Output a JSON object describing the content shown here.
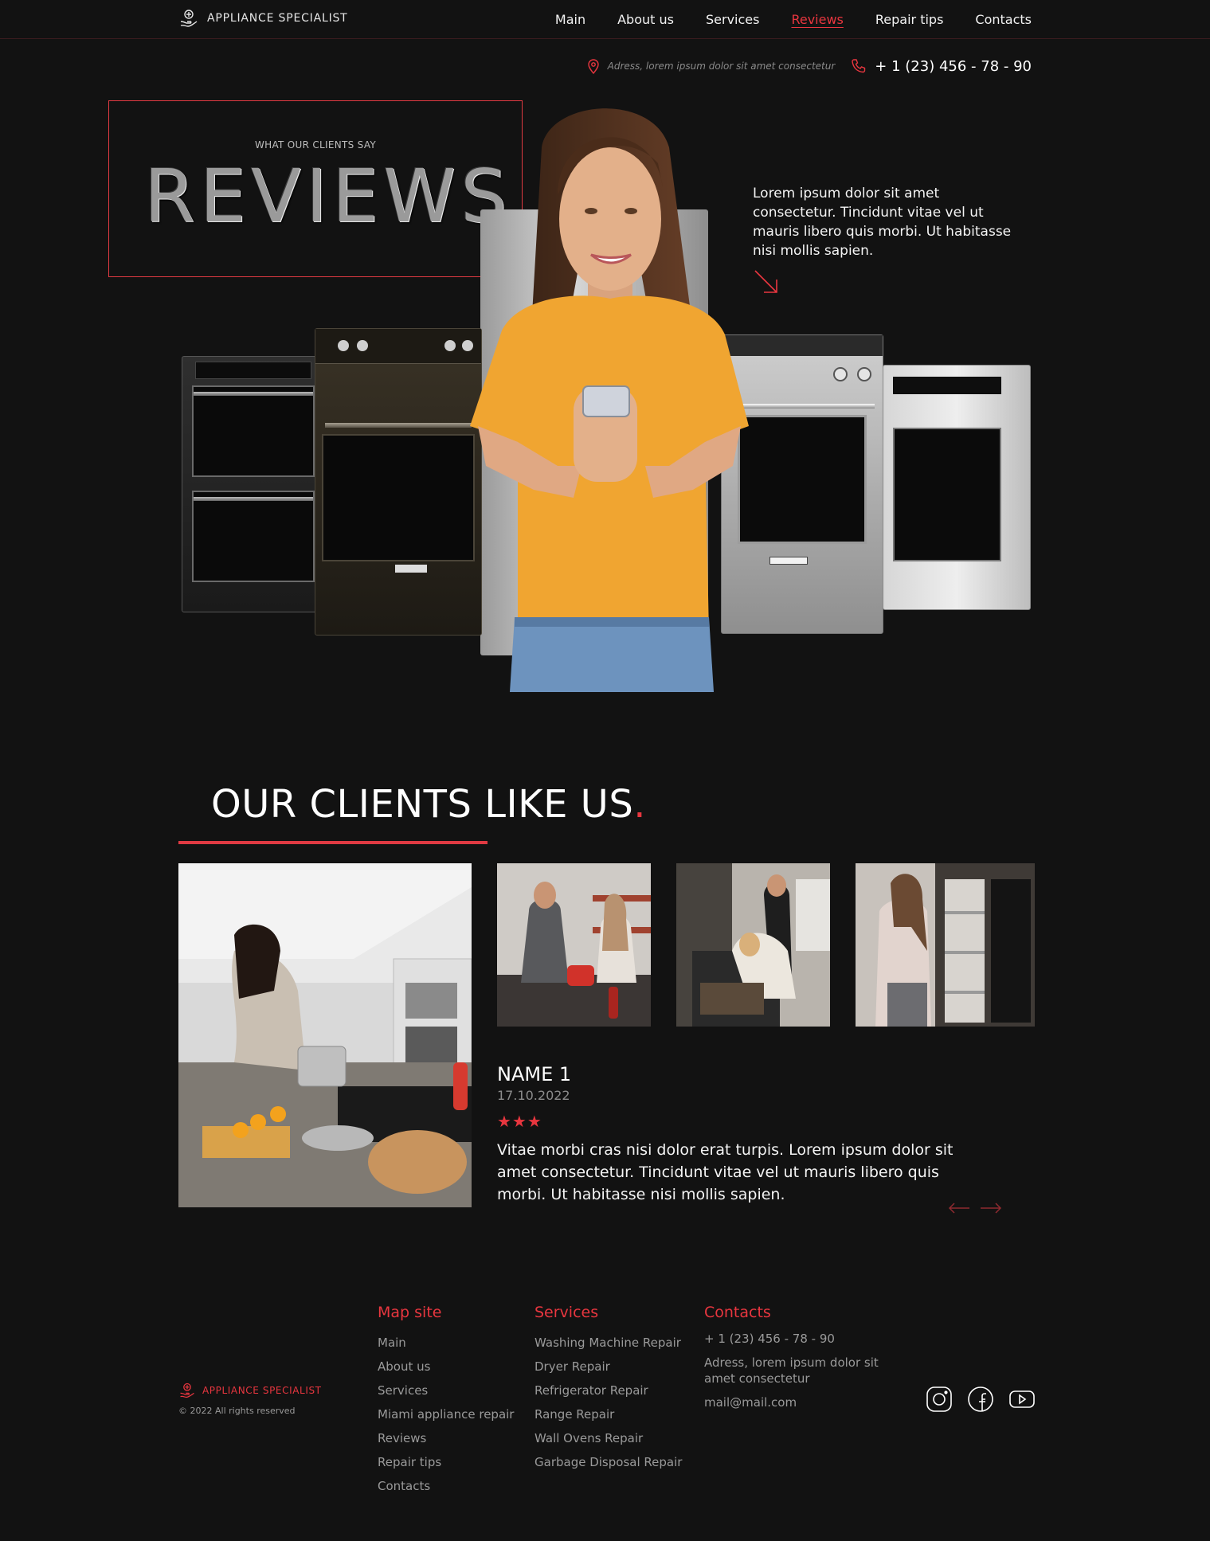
{
  "header": {
    "logo_text": "APPLIANCE SPECIALIST",
    "nav": [
      {
        "label": "Main",
        "active": false
      },
      {
        "label": "About us",
        "active": false
      },
      {
        "label": "Services",
        "active": false
      },
      {
        "label": "Reviews",
        "active": true
      },
      {
        "label": "Repair tips",
        "active": false
      },
      {
        "label": "Contacts",
        "active": false
      }
    ]
  },
  "contact_strip": {
    "address": "Adress, lorem ipsum dolor sit amet consectetur",
    "phone": "+ 1 (23) 456 - 78 - 90"
  },
  "hero": {
    "subtitle": "WHAT OUR CLIENTS SAY",
    "title": "REVIEWS",
    "title_dot": ".",
    "text": "Lorem ipsum dolor sit amet consectetur. Tincidunt vitae vel ut mauris libero quis morbi. Ut habitasse nisi mollis sapien."
  },
  "clients": {
    "title": "OUR CLIENTS LIKE US",
    "title_dot": ".",
    "review": {
      "name": "NAME 1",
      "date": "17.10.2022",
      "stars": "★★★",
      "rating": 3,
      "text": "Vitae morbi cras nisi dolor erat turpis. Lorem ipsum dolor sit amet consectetur. Tincidunt vitae vel ut mauris libero quis morbi. Ut habitasse nisi mollis sapien."
    }
  },
  "footer": {
    "logo_text": "APPLIANCE SPECIALIST",
    "copyright": "© 2022 All rights reserved",
    "map": {
      "title": "Map site",
      "items": [
        "Main",
        "About us",
        "Services",
        "Miami appliance repair",
        "Reviews",
        "Repair tips",
        "Contacts"
      ]
    },
    "services": {
      "title": "Services",
      "items": [
        "Washing Machine Repair",
        "Dryer Repair",
        "Refrigerator Repair",
        "Range Repair",
        "Wall Ovens Repair",
        "Garbage Disposal Repair"
      ]
    },
    "contacts": {
      "title": "Contacts",
      "phone": "+ 1 (23) 456 - 78 - 90",
      "address": "Adress, lorem ipsum dolor sit amet consectetur",
      "email": "mail@mail.com"
    },
    "social": [
      "instagram-icon",
      "facebook-icon",
      "youtube-icon"
    ]
  },
  "colors": {
    "background": "#121212",
    "accent": "#e8363f",
    "muted_text": "#9a9a9a"
  }
}
